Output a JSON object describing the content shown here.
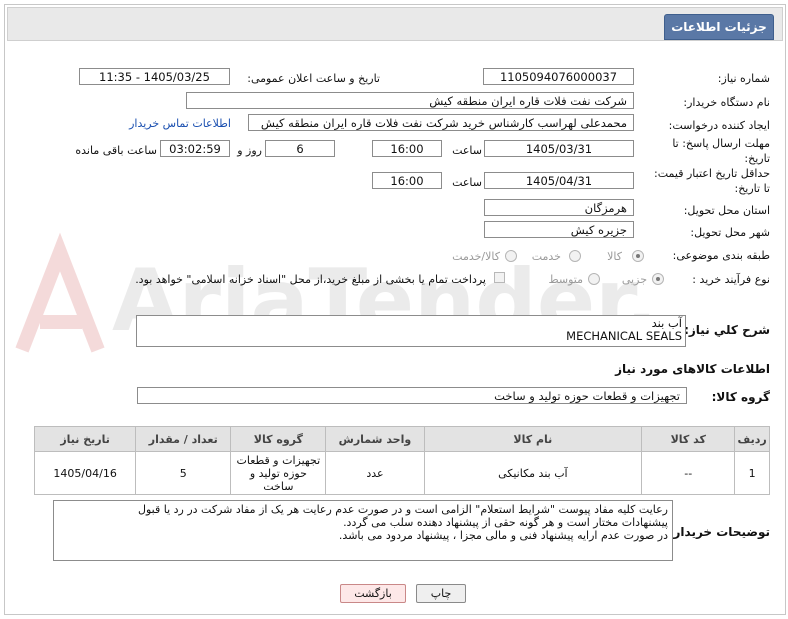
{
  "header": {
    "title": "جزئیات اطلاعات نیاز"
  },
  "fields": {
    "need_number_label": "شماره نیاز:",
    "need_number": "1105094076000037",
    "announce_label": "تاریخ و ساعت اعلان عمومی:",
    "announce_value": "1405/03/25 - 11:35",
    "buyer_org_label": "نام دستگاه خریدار:",
    "buyer_org": "شرکت نفت فلات قاره ایران منطقه کیش",
    "creator_label": "ایجاد کننده درخواست:",
    "creator": "محمدعلی لهراسب کارشناس خرید شرکت نفت فلات قاره ایران منطقه کیش",
    "contact_link": "اطلاعات تماس خریدار",
    "deadline_label_1": "مهلت ارسال پاسخ: تا",
    "deadline_label_2": "تاریخ:",
    "deadline_date": "1405/03/31",
    "time_label": "ساعت",
    "deadline_time": "16:00",
    "days_value": "6",
    "days_label": "روز و",
    "remaining_time": "03:02:59",
    "remaining_label": "ساعت باقی مانده",
    "validity_label_1": "حداقل تاریخ اعتبار قیمت:",
    "validity_label_2": "تا تاریخ:",
    "validity_date": "1405/04/31",
    "validity_time_label": "ساعت",
    "validity_time": "16:00",
    "province_label": "استان محل تحویل:",
    "province": "هرمزگان",
    "city_label": "شهر محل تحویل:",
    "city": "جزیره کیش",
    "category_label": "طبقه بندی موضوعی:",
    "category_options": [
      "کالا",
      "خدمت",
      "کالا/خدمت"
    ],
    "purchase_type_label": "نوع فرآیند خرید :",
    "purchase_options": [
      "جزیی",
      "متوسط"
    ],
    "payment_note": "پرداخت تمام یا بخشی از مبلغ خرید،از محل \"اسناد خزانه اسلامی\" خواهد بود."
  },
  "description": {
    "label": "شرح کلي نياز:",
    "line1": "آب بند",
    "line2": "MECHANICAL SEALS"
  },
  "goods_section": {
    "title": "اطلاعات کالاهای مورد نیاز",
    "group_label": "گروه کالا:",
    "group_value": "تجهیزات و قطعات حوزه تولید و ساخت"
  },
  "table": {
    "headers": [
      "ردیف",
      "کد کالا",
      "نام کالا",
      "واحد شمارش",
      "گروه کالا",
      "تعداد / مقدار",
      "تاریخ نیاز"
    ],
    "rows": [
      [
        "1",
        "--",
        "آب بند مکانیکی",
        "عدد",
        "تجهیزات و قطعات حوزه تولید و ساخت",
        "5",
        "1405/04/16"
      ]
    ]
  },
  "buyer_notes": {
    "label": "توضیحات خریدار:",
    "line1": "رعایت کلیه مفاد  پیوست \"شرایط استعلام\" الزامی است و در صورت عدم رعایت هر یک از مفاد شرکت در رد یا قبول",
    "line2": "پیشنهادات مختار است  و هر گونه حقی از پیشنهاد دهنده سلب می گردد.",
    "line3": "در صورت عدم ارایه پیشنهاد فنی و مالی مجزا ، پیشنهاد مردود می باشد."
  },
  "buttons": {
    "print": "چاپ",
    "back": "بازگشت"
  },
  "watermark": "AriaTender.net",
  "colors": {
    "header_tab": "#5a78a6",
    "back_button_bg": "#fde8e8",
    "back_button_border": "#c98888",
    "link": "#1a4fb0"
  }
}
